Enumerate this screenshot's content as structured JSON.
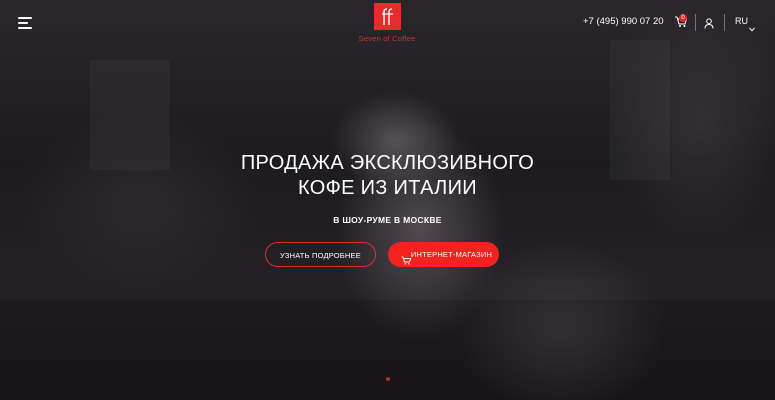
{
  "header": {
    "logo_text": "Seven of Coffee",
    "phone": "+7 (495) 990 07 20",
    "cart_count": "0",
    "language": "RU"
  },
  "hero": {
    "title_line1": "ПРОДАЖА ЭКСКЛЮЗИВНОГО",
    "title_line2": "КОФЕ ИЗ ИТАЛИИ",
    "subtitle": "В ШОУ-РУМЕ В МОСКВЕ",
    "primary_button": "УЗНАТЬ ПОДРОБНЕЕ",
    "secondary_button": "ИНТЕРНЕТ-МАГАЗИН"
  },
  "icons": {
    "menu": "menu-icon",
    "logo": "logo-mark",
    "cart": "cart-icon",
    "user": "user-icon",
    "language_dropdown": "chevron-down-icon",
    "shop_button": "cart-icon"
  },
  "colors": {
    "accent": "#e52b2b",
    "button_fill": "#f2221f",
    "text": "#ffffff",
    "background": "#1d1b1f"
  }
}
